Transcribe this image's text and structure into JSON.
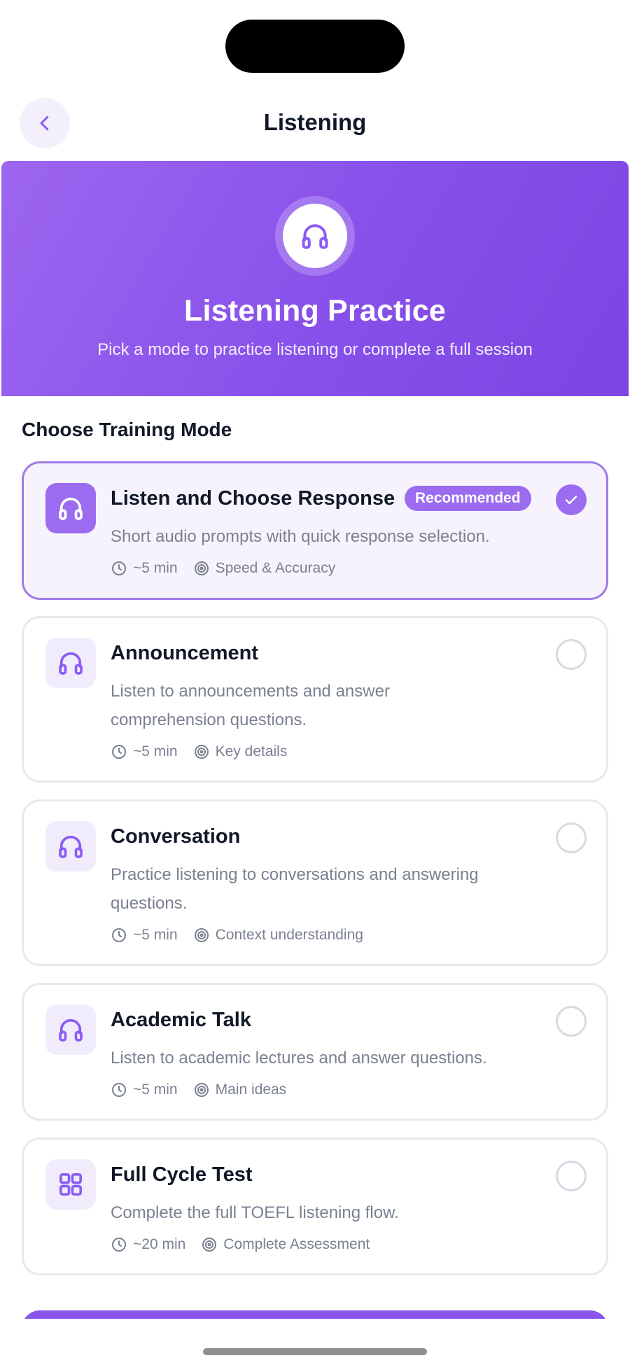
{
  "header": {
    "title": "Listening"
  },
  "hero": {
    "title": "Listening Practice",
    "subtitle": "Pick a mode to practice listening or complete a full session",
    "icon": "headphones-icon"
  },
  "section": {
    "title": "Choose Training Mode"
  },
  "modes": [
    {
      "title": "Listen and Choose Response",
      "badge": "Recommended",
      "description": "Short audio prompts with quick response selection.",
      "duration": "~5 min",
      "focus": "Speed & Accuracy",
      "icon": "headphones-icon",
      "selected": true
    },
    {
      "title": "Announcement",
      "description": "Listen to announcements and answer comprehension questions.",
      "duration": "~5 min",
      "focus": "Key details",
      "icon": "headphones-icon",
      "selected": false
    },
    {
      "title": "Conversation",
      "description": "Practice listening to conversations and answering questions.",
      "duration": "~5 min",
      "focus": "Context understanding",
      "icon": "headphones-icon",
      "selected": false
    },
    {
      "title": "Academic Talk",
      "description": "Listen to academic lectures and answer questions.",
      "duration": "~5 min",
      "focus": "Main ideas",
      "icon": "headphones-icon",
      "selected": false
    },
    {
      "title": "Full Cycle Test",
      "description": "Complete the full TOEFL listening flow.",
      "duration": "~20 min",
      "focus": "Complete Assessment",
      "icon": "grid-icon",
      "selected": false
    }
  ],
  "colors": {
    "accent": "#9b6cf0",
    "hero_start": "#9d66f0",
    "hero_end": "#7c45e2",
    "muted_text": "#7a8190",
    "card_border": "#e7e9ee"
  }
}
